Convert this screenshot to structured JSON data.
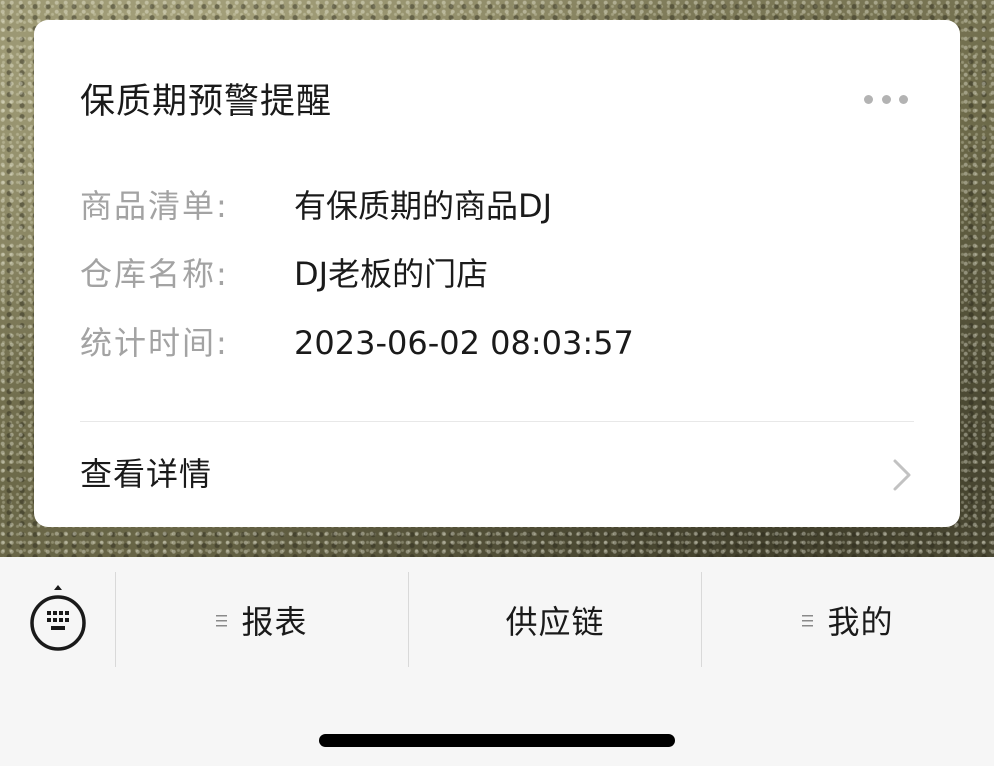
{
  "card": {
    "title": "保质期预警提醒",
    "more_icon": "more-horizontal-icon",
    "fields": [
      {
        "label": "商品清单:",
        "value": "有保质期的商品DJ"
      },
      {
        "label": "仓库名称:",
        "value": "DJ老板的门店"
      },
      {
        "label": "统计时间:",
        "value": "2023-06-02 08:03:57"
      }
    ],
    "detail_link": "查看详情",
    "detail_icon": "chevron-right-icon"
  },
  "tabbar": {
    "keyboard_icon": "keyboard-icon",
    "tabs": [
      {
        "label": "报表",
        "icon": "menu-icon"
      },
      {
        "label": "供应链"
      },
      {
        "label": "我的",
        "icon": "menu-icon"
      }
    ]
  },
  "colors": {
    "label_gray": "#a3a3a3",
    "text_dark": "#1a1a1a",
    "card_bg": "#ffffff",
    "tabbar_bg": "#f6f6f6"
  }
}
